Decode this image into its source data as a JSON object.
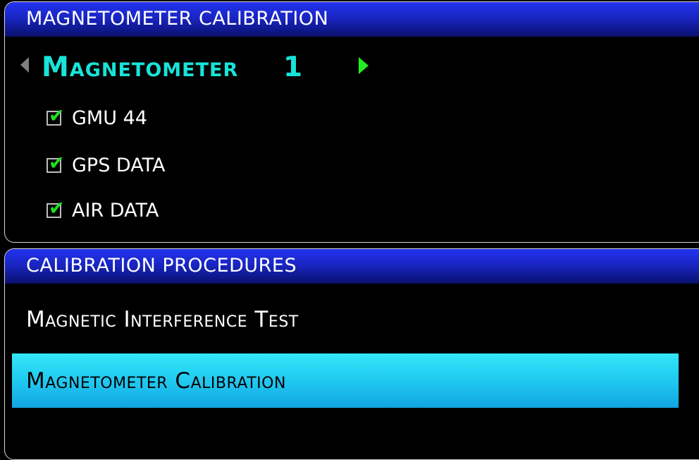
{
  "top_panel": {
    "title": "MAGNETOMETER CALIBRATION",
    "selector": {
      "label": "Magnetometer",
      "number": "1"
    },
    "items": [
      {
        "label": "GMU 44",
        "checked": true
      },
      {
        "label": "GPS DATA",
        "checked": true
      },
      {
        "label": "AIR DATA",
        "checked": true
      }
    ]
  },
  "bottom_panel": {
    "title": "CALIBRATION PROCEDURES",
    "procedures": [
      {
        "label": "Magnetic Interference Test",
        "selected": false
      },
      {
        "label": "Magnetometer Calibration",
        "selected": true
      }
    ]
  },
  "colors": {
    "header": "#1a26c4",
    "selector_text": "#18e3d8",
    "check": "#1ee11e",
    "highlight": "#1fc6ef"
  },
  "icons": {
    "prev": "left-arrow-icon",
    "next": "right-arrow-icon",
    "check": "checkmark-icon"
  }
}
